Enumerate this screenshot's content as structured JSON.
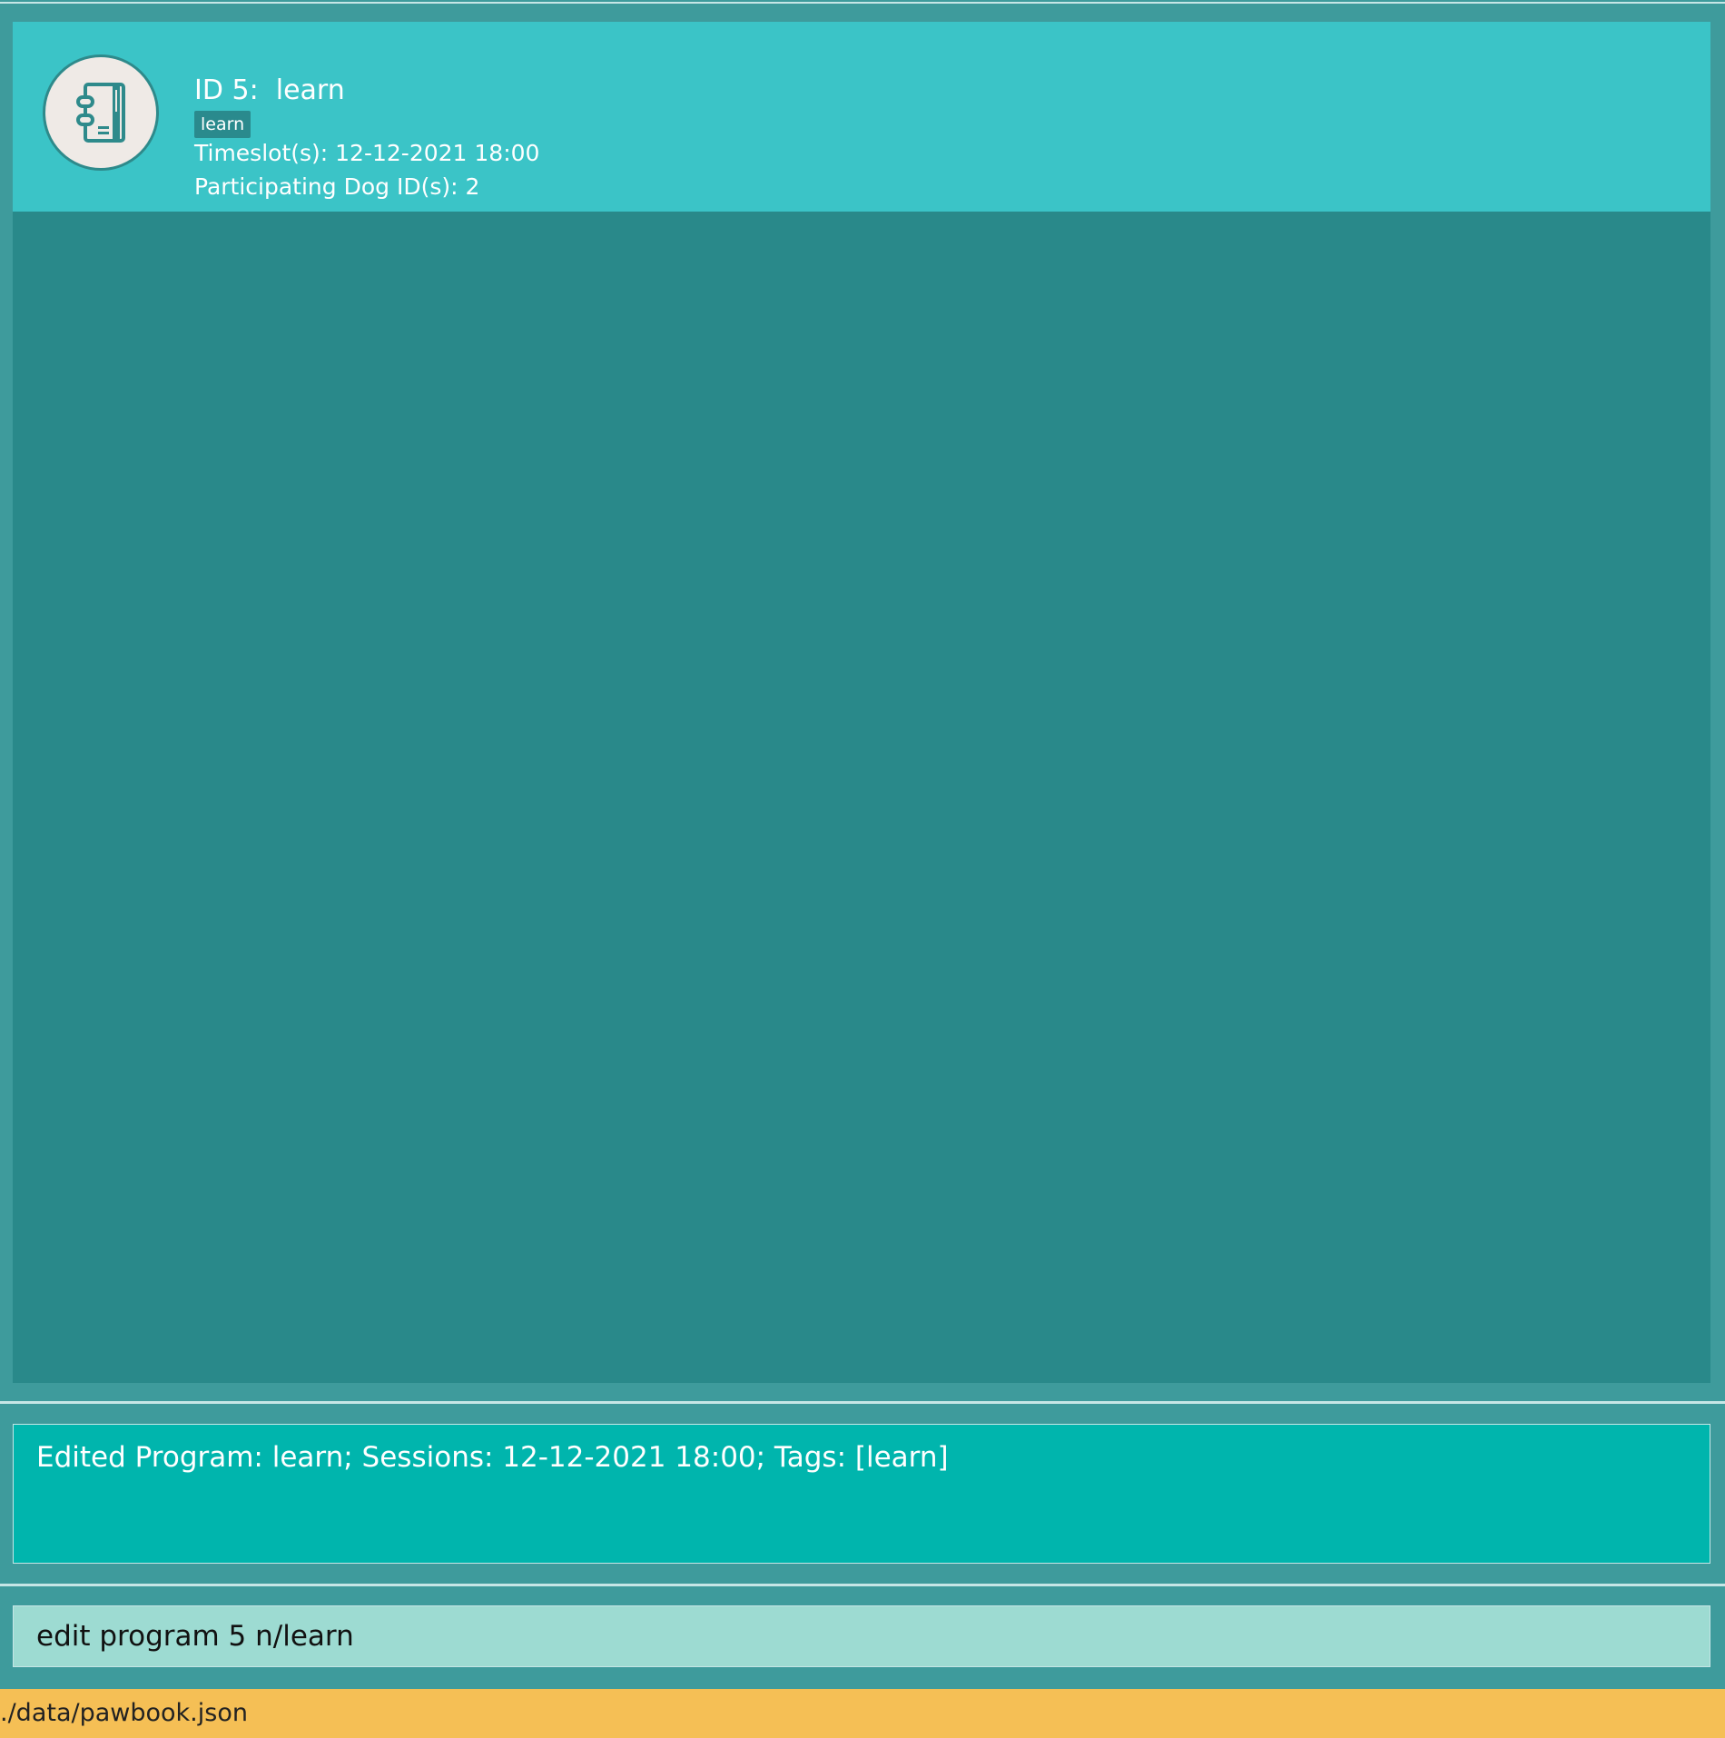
{
  "program_list": {
    "items": [
      {
        "title": "ID 5:  learn",
        "tags": [
          "learn"
        ],
        "timeslot": "Timeslot(s): 12-12-2021 18:00",
        "dogs": "Participating Dog ID(s): 2",
        "icon": "notebook-icon"
      }
    ]
  },
  "result_display": {
    "text": "Edited Program: learn; Sessions: 12-12-2021 18:00; Tags: [learn]"
  },
  "command_box": {
    "value": "edit program 5 n/learn",
    "placeholder": ""
  },
  "status_bar": {
    "file_path": "./data/pawbook.json"
  },
  "colors": {
    "background": "#3e9b9c",
    "list_panel": "#29898a",
    "card": "#3bc4c7",
    "tag": "#2a8a8d",
    "result_box": "#00b5ad",
    "command_box": "#9ddbd2",
    "status_bar": "#f5bf55"
  }
}
